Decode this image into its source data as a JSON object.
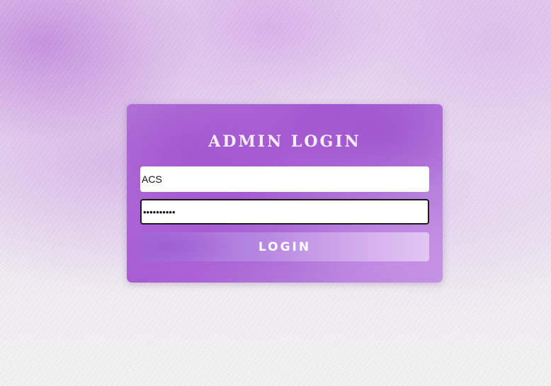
{
  "login": {
    "title": "ADMIN LOGIN",
    "username_value": "ACS",
    "password_value": "••••••••••",
    "button_label": "LOGIN"
  },
  "colors": {
    "card_accent": "#a65ad2",
    "background_tint": "#e6cdef",
    "button_text": "#ffffff"
  }
}
